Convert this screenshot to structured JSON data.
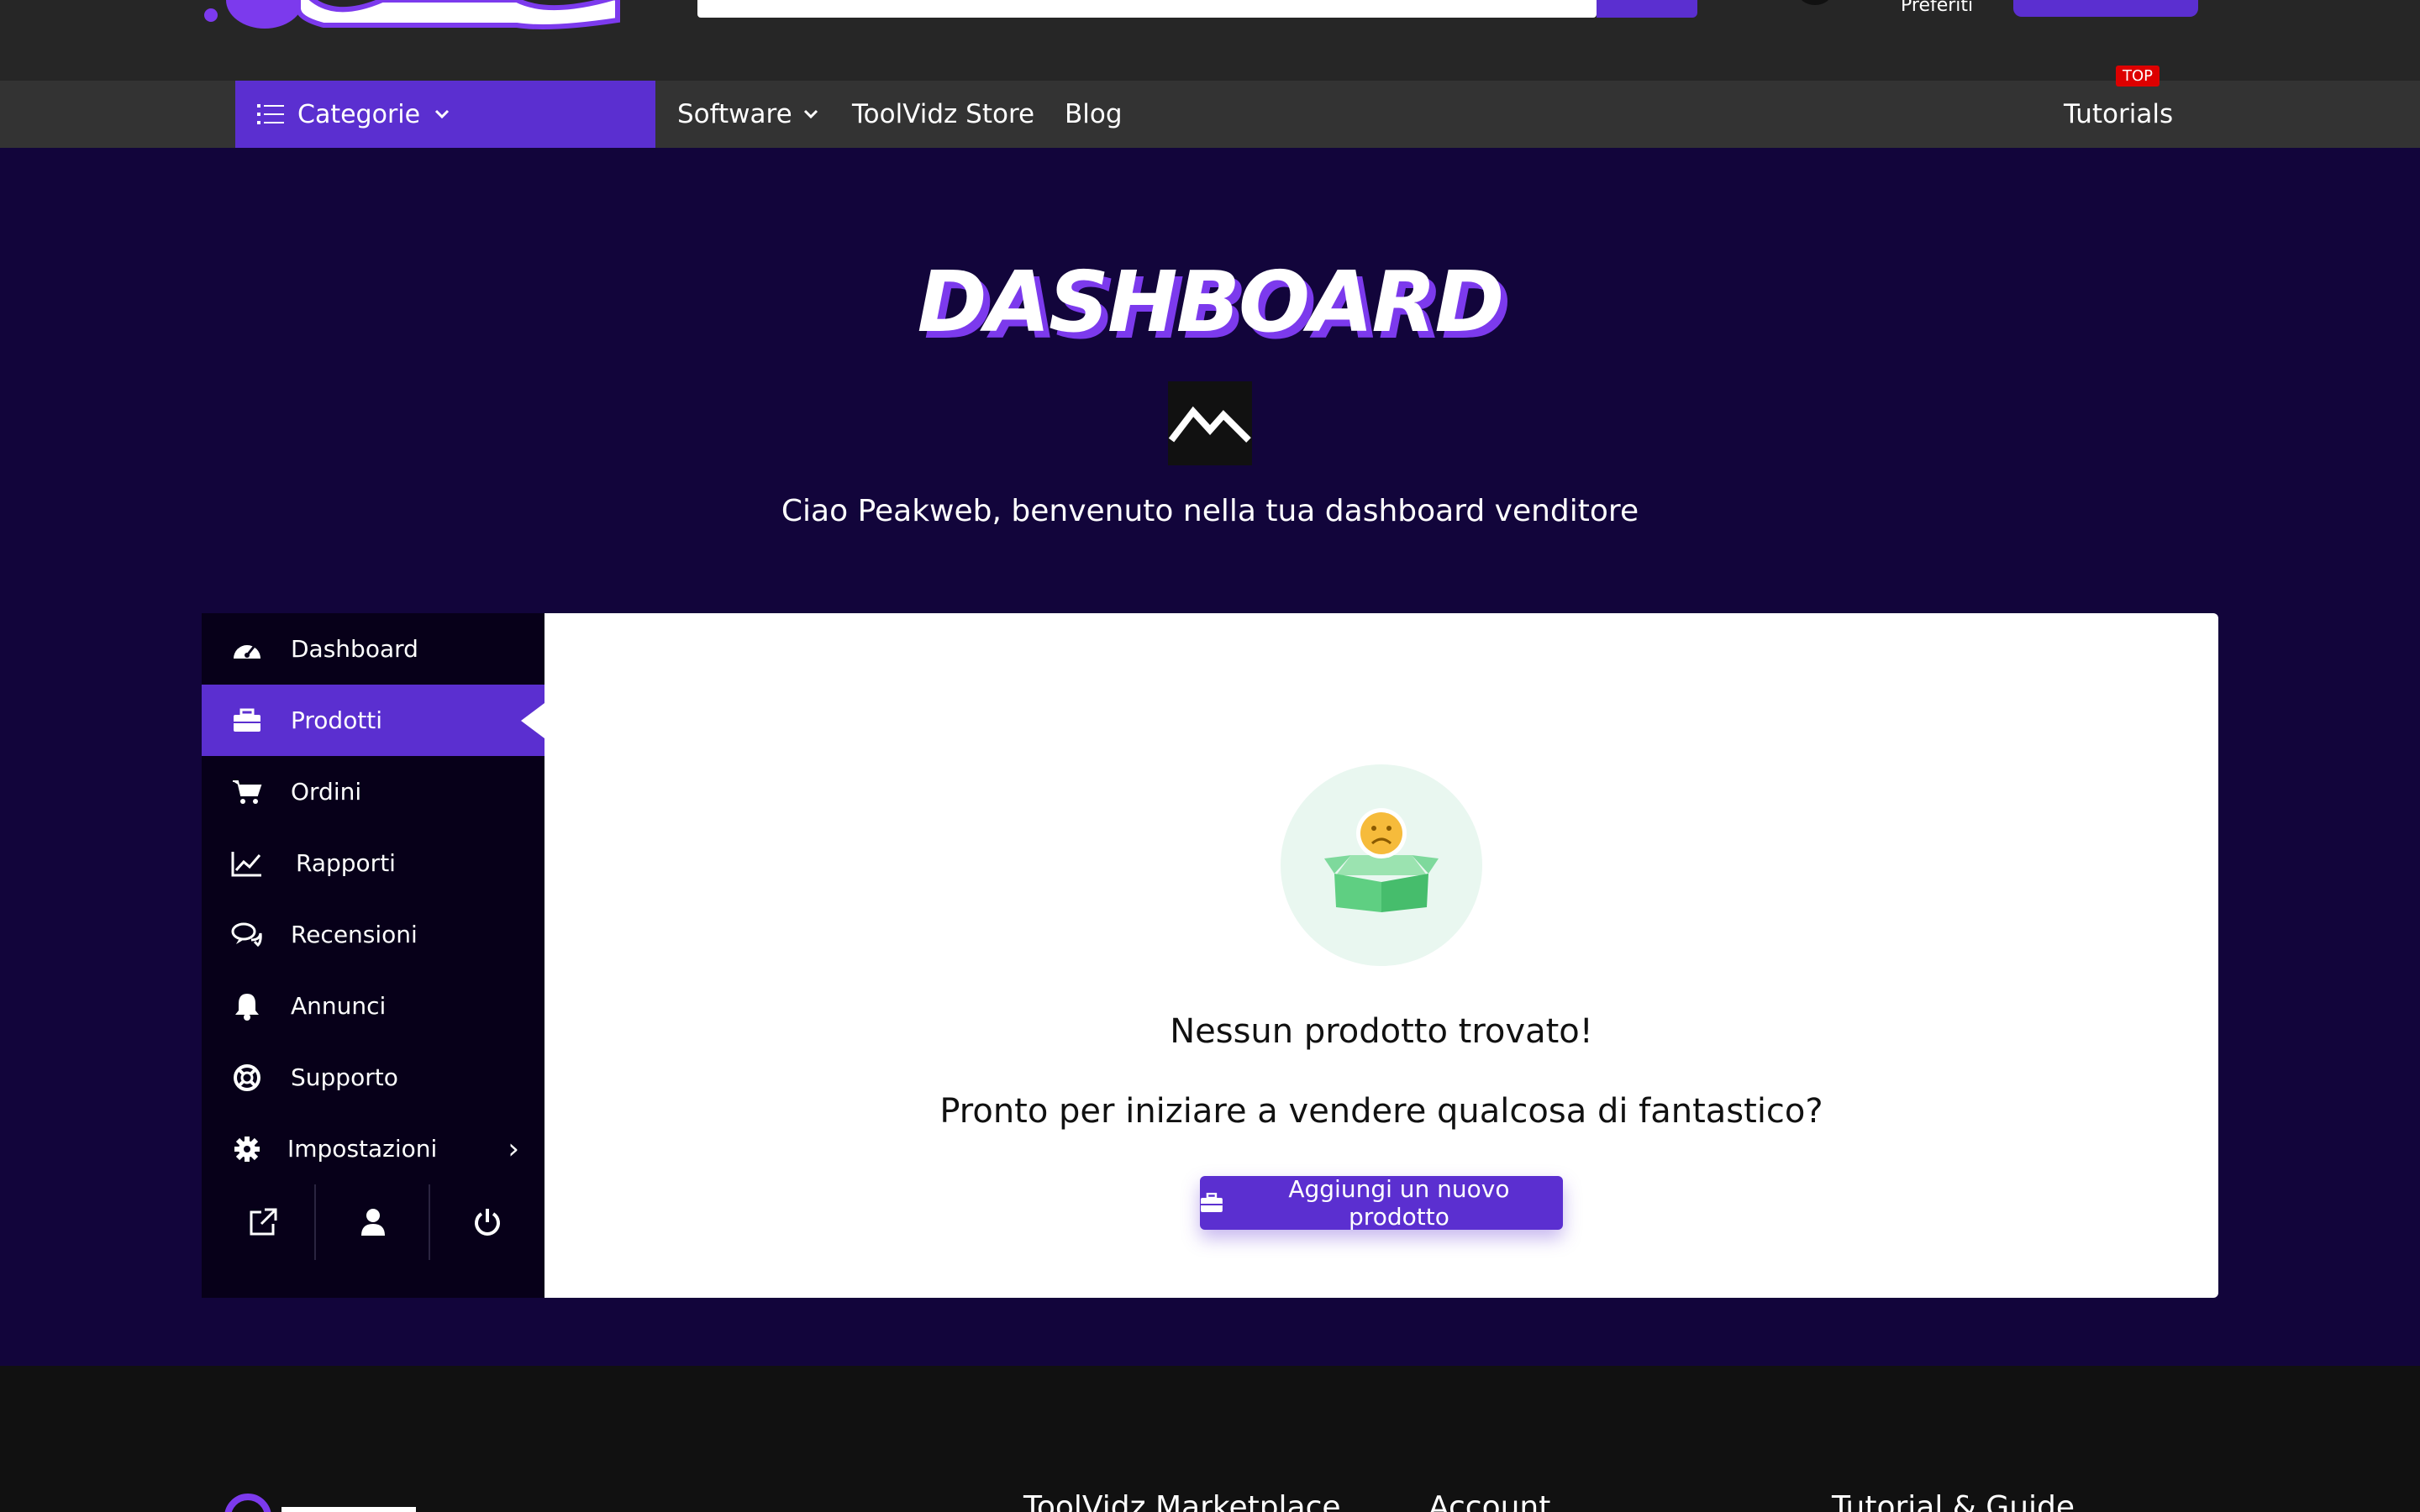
{
  "header": {
    "favorites_label": "Preferiti"
  },
  "nav": {
    "categories_label": "Categorie",
    "items": [
      "Software",
      "ToolVidz Store",
      "Blog"
    ],
    "tutorials_label": "Tutorials",
    "top_badge": "TOP"
  },
  "hero": {
    "title": "DASHBOARD",
    "greeting": "Ciao Peakweb, benvenuto nella tua dashboard venditore"
  },
  "sidebar": {
    "items": [
      {
        "label": "Dashboard",
        "icon": "tachometer-icon"
      },
      {
        "label": "Prodotti",
        "icon": "briefcase-icon",
        "active": true
      },
      {
        "label": "Ordini",
        "icon": "cart-icon"
      },
      {
        "label": "Rapporti",
        "icon": "chart-line-icon"
      },
      {
        "label": "Recensioni",
        "icon": "comments-icon"
      },
      {
        "label": "Annunci",
        "icon": "bell-icon"
      },
      {
        "label": "Supporto",
        "icon": "lifebuoy-icon"
      },
      {
        "label": "Impostazioni",
        "icon": "gear-icon"
      }
    ]
  },
  "main": {
    "empty_title": "Nessun prodotto trovato!",
    "empty_subtitle": "Pronto per iniziare a vendere qualcosa di fantastico?",
    "add_button_label": "Aggiungi un nuovo prodotto"
  },
  "footer": {
    "columns": [
      "ToolVidz Marketplace",
      "Account",
      "Tutorial & Guide"
    ]
  },
  "colors": {
    "accent": "#5b2fd0",
    "hero_bg": "#12053b",
    "sidebar_bg": "#070019",
    "navbar_bg": "#333333"
  }
}
